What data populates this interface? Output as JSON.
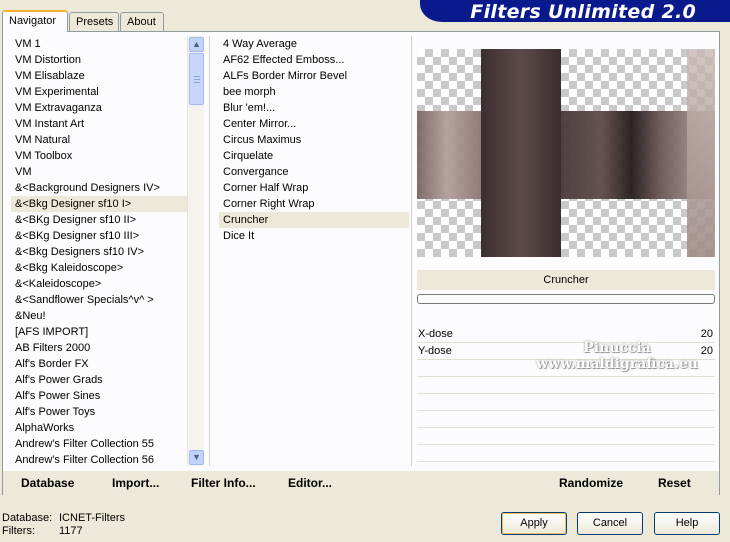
{
  "app": {
    "title": "Filters Unlimited 2.0"
  },
  "tabs": [
    "Navigator",
    "Presets",
    "About"
  ],
  "categories": {
    "items": [
      "VM 1",
      "VM Distortion",
      "VM Elisablaze",
      "VM Experimental",
      "VM Extravaganza",
      "VM Instant Art",
      "VM Natural",
      "VM Toolbox",
      "VM",
      "&<Background Designers IV>",
      "&<Bkg Designer sf10 I>",
      "&<BKg Designer sf10 II>",
      "&<BKg Designer sf10 III>",
      "&<Bkg Designers sf10 IV>",
      "&<Bkg Kaleidoscope>",
      "&<Kaleidoscope>",
      "&<Sandflower Specials^v^ >",
      "&Neu!",
      "[AFS IMPORT]",
      "AB Filters 2000",
      "Alf's Border FX",
      "Alf's Power Grads",
      "Alf's Power Sines",
      "Alf's Power Toys",
      "AlphaWorks",
      "Andrew's Filter Collection 55",
      "Andrew's Filter Collection 56"
    ],
    "selected": "&<Bkg Designer sf10 I>"
  },
  "filters": {
    "items": [
      "4 Way Average",
      "AF62 Effected Emboss...",
      "ALFs Border Mirror Bevel",
      "bee morph",
      "Blur 'em!...",
      "Center Mirror...",
      "Circus Maximus",
      "Cirquelate",
      "Convergance",
      "Corner Half Wrap",
      "Corner Right Wrap",
      "Cruncher",
      "Dice It"
    ],
    "selected": "Cruncher"
  },
  "preview": {
    "filter_name": "Cruncher"
  },
  "params": [
    {
      "label": "X-dose",
      "value": "20"
    },
    {
      "label": "Y-dose",
      "value": "20"
    }
  ],
  "toolbar": {
    "database": "Database",
    "import": "Import...",
    "filter_info": "Filter Info...",
    "editor": "Editor...",
    "randomize": "Randomize",
    "reset": "Reset"
  },
  "status": {
    "database_label": "Database:",
    "database_value": "ICNET-Filters",
    "filters_label": "Filters:",
    "filters_value": "1177"
  },
  "buttons": {
    "apply": "Apply",
    "cancel": "Cancel",
    "help": "Help"
  },
  "watermark": {
    "line1": "Pinuccia",
    "line2": "www.maldigrafica.eu"
  }
}
